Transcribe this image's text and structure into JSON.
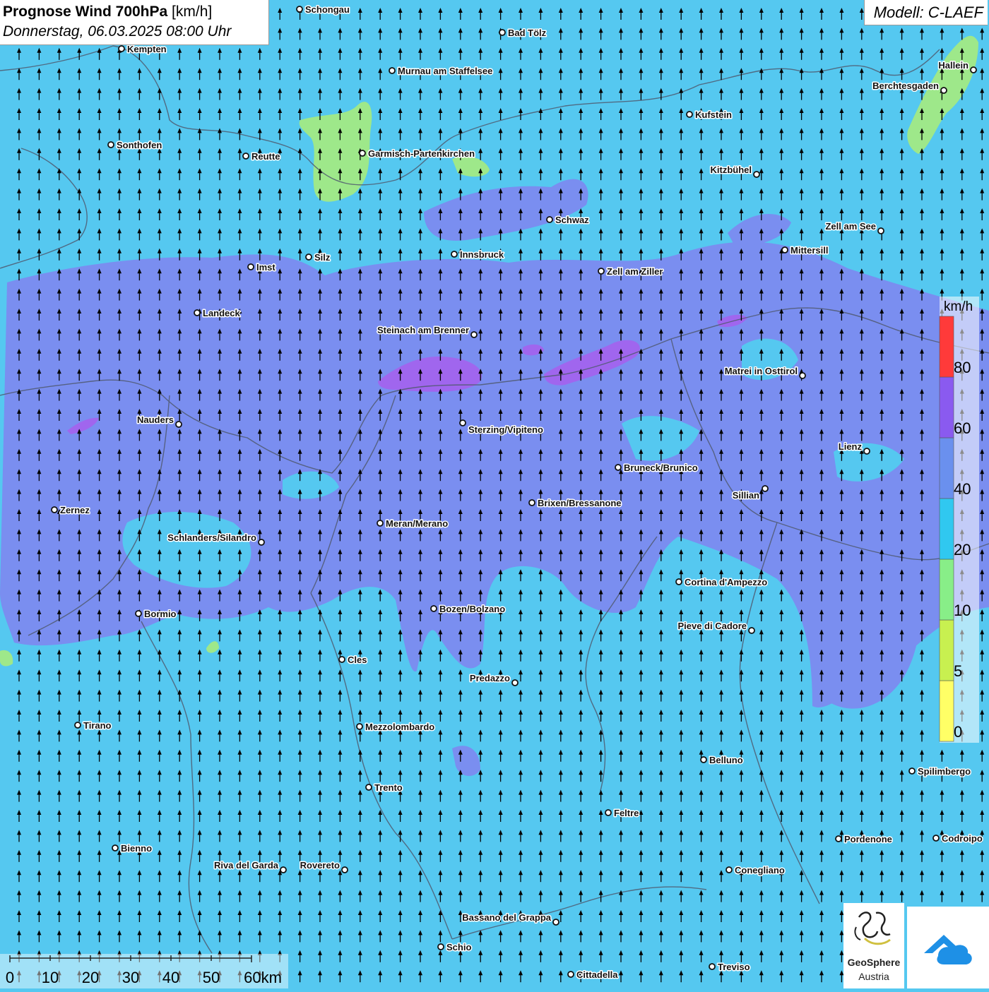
{
  "header": {
    "title_bold": "Prognose Wind 700hPa",
    "title_unit": "[km/h]",
    "date": "Donnerstag, 06.03.2025 08:00 Uhr"
  },
  "model": {
    "label": "Modell: C-LAEF"
  },
  "legend": {
    "unit": "km/h",
    "classes": [
      {
        "from": 0,
        "color": "#ffff66"
      },
      {
        "from": 5,
        "color": "#c8f050"
      },
      {
        "from": 10,
        "color": "#88ee88"
      },
      {
        "from": 20,
        "color": "#30c8f0"
      },
      {
        "from": 40,
        "color": "#6a90ee"
      },
      {
        "from": 60,
        "color": "#8a5af0"
      },
      {
        "from": 80,
        "color": "#ff3a3a"
      }
    ],
    "labels": [
      "80",
      "60",
      "40",
      "20",
      "10",
      "5",
      "0"
    ]
  },
  "scale": {
    "labels": [
      "0",
      "10",
      "20",
      "30",
      "40",
      "50",
      "60km"
    ]
  },
  "wind": {
    "direction": "north",
    "arrow_color": "#000000"
  },
  "cities": [
    {
      "name": "Schongau"
    },
    {
      "name": "Bad Tölz"
    },
    {
      "name": "Kempten"
    },
    {
      "name": "Murnau am Staffelsee"
    },
    {
      "name": "Hallein"
    },
    {
      "name": "Berchtesgaden"
    },
    {
      "name": "Kufstein"
    },
    {
      "name": "Sonthofen"
    },
    {
      "name": "Reutte"
    },
    {
      "name": "Garmisch-Partenkirchen"
    },
    {
      "name": "Kitzbühel"
    },
    {
      "name": "Schwaz"
    },
    {
      "name": "Zell am See"
    },
    {
      "name": "Mittersill"
    },
    {
      "name": "Silz"
    },
    {
      "name": "Innsbruck"
    },
    {
      "name": "Imst"
    },
    {
      "name": "Zell am Ziller"
    },
    {
      "name": "Landeck"
    },
    {
      "name": "Steinach am Brenner"
    },
    {
      "name": "Matrei in Osttirol"
    },
    {
      "name": "Nauders"
    },
    {
      "name": "Sterzing/Vipiteno"
    },
    {
      "name": "Lienz"
    },
    {
      "name": "Bruneck/Brunico"
    },
    {
      "name": "Sillian"
    },
    {
      "name": "Zernez"
    },
    {
      "name": "Brixen/Bressanone"
    },
    {
      "name": "Meran/Merano"
    },
    {
      "name": "Schlanders/Silandro"
    },
    {
      "name": "Cortina d'Ampezzo"
    },
    {
      "name": "Bozen/Bolzano"
    },
    {
      "name": "Bormio"
    },
    {
      "name": "Pieve di Cadore"
    },
    {
      "name": "Cles"
    },
    {
      "name": "Predazzo"
    },
    {
      "name": "Tirano"
    },
    {
      "name": "Mezzolombardo"
    },
    {
      "name": "Belluno"
    },
    {
      "name": "Spilimbergo"
    },
    {
      "name": "Trento"
    },
    {
      "name": "Feltre"
    },
    {
      "name": "Bienno"
    },
    {
      "name": "Pordenone"
    },
    {
      "name": "Codroipo"
    },
    {
      "name": "Riva del Garda"
    },
    {
      "name": "Rovereto"
    },
    {
      "name": "Conegliano"
    },
    {
      "name": "Bassano del Grappa"
    },
    {
      "name": "Schio"
    },
    {
      "name": "Treviso"
    },
    {
      "name": "Cittadella"
    }
  ],
  "logos": {
    "brand_line1": "GeoSphere",
    "brand_line2": "Austria"
  }
}
